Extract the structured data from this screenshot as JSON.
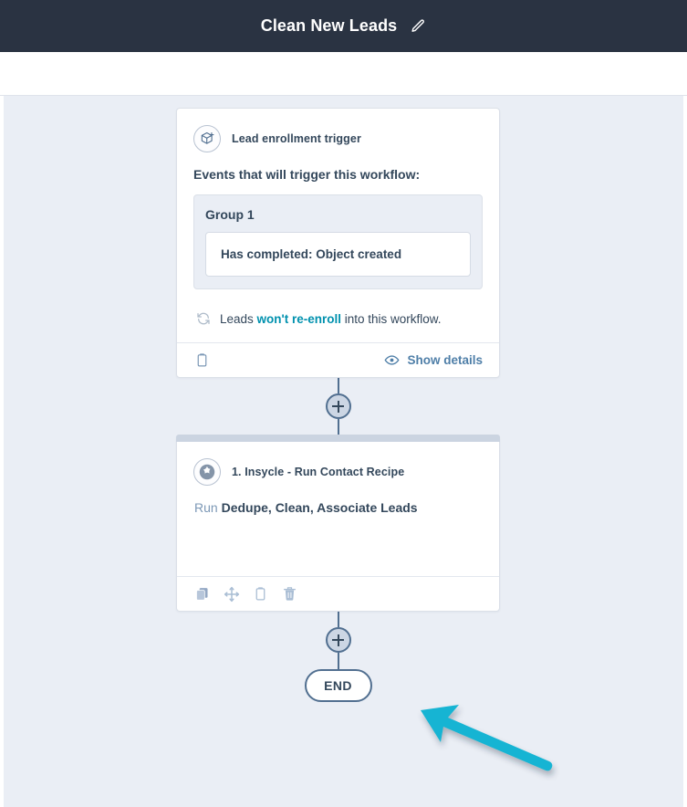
{
  "header": {
    "title": "Clean New Leads",
    "edit_icon": "pencil-icon",
    "bg_color": "#2a3342"
  },
  "canvas": {
    "bg_color": "#eaeef5"
  },
  "trigger_card": {
    "icon": "object-created-trigger-icon",
    "header_label": "Lead enrollment trigger",
    "events_label": "Events that will trigger this workflow:",
    "group": {
      "title": "Group 1",
      "criteria": [
        "Has completed: Object created"
      ]
    },
    "reenroll": {
      "icon": "refresh-icon",
      "prefix": "Leads ",
      "emphasis": "won't re-enroll",
      "suffix": " into this workflow.",
      "emphasis_color": "#0091ae"
    },
    "footer": {
      "copy_icon": "clipboard-icon",
      "show_details_icon": "eye-icon",
      "show_details_label": "Show details",
      "link_color": "#4f7fa8"
    }
  },
  "connectors": {
    "add_step_label": "+"
  },
  "action_card": {
    "icon": "insycle-logo-icon",
    "header_label": "1. Insycle - Run Contact Recipe",
    "description_prefix": "Run ",
    "description_bold": "Dedupe, Clean, Associate Leads",
    "tools": [
      "duplicate-icon",
      "move-icon",
      "clipboard-icon",
      "delete-icon"
    ]
  },
  "end_node": {
    "label": "END"
  },
  "annotation": {
    "arrow_color": "#17b4d3",
    "points_to": "action-card"
  }
}
